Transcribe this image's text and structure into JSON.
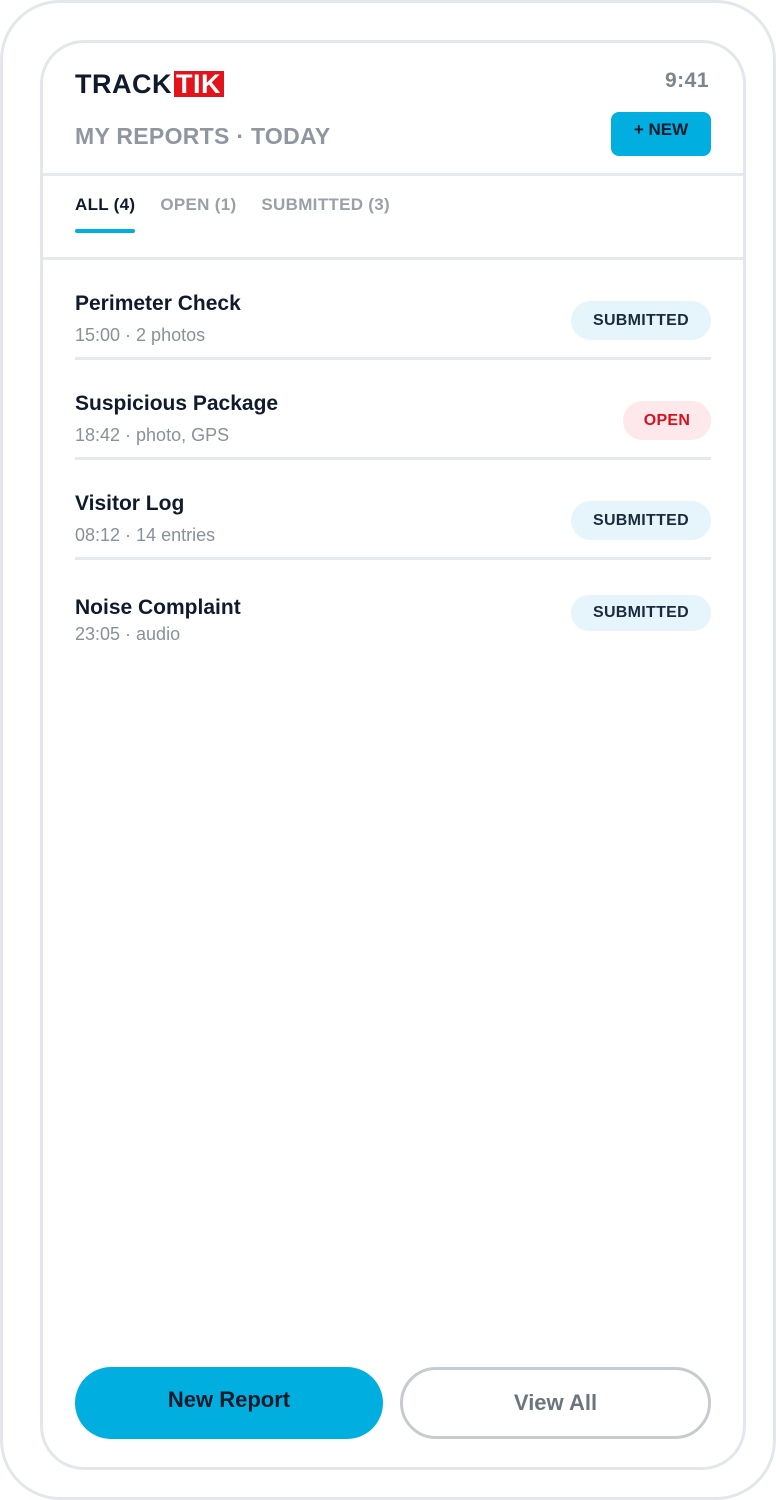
{
  "app": {
    "logo_left": "TRACK",
    "logo_right": "TIK",
    "clock": "9:41"
  },
  "header": {
    "title": "MY REPORTS · TODAY",
    "new_button": "+ NEW"
  },
  "tabs": [
    {
      "label": "ALL (4)",
      "active": true
    },
    {
      "label": "OPEN (1)",
      "active": false
    },
    {
      "label": "SUBMITTED (3)",
      "active": false
    }
  ],
  "reports": [
    {
      "title": "Perimeter Check",
      "meta": "15:00 · 2 photos",
      "status": "SUBMITTED"
    },
    {
      "title": "Suspicious Package",
      "meta": "18:42 · photo, GPS",
      "status": "OPEN"
    },
    {
      "title": "Visitor Log",
      "meta": "08:12 · 14 entries",
      "status": "SUBMITTED"
    },
    {
      "title": "Noise Complaint",
      "meta": "23:05 · audio",
      "status": "SUBMITTED"
    }
  ],
  "actions": {
    "primary": "New Report",
    "secondary": "View All"
  },
  "colors": {
    "accent": "#00aee0",
    "brand_red": "#e3131b",
    "status_open": "#d7121e",
    "status_submitted_bg": "#e6f5fb"
  }
}
